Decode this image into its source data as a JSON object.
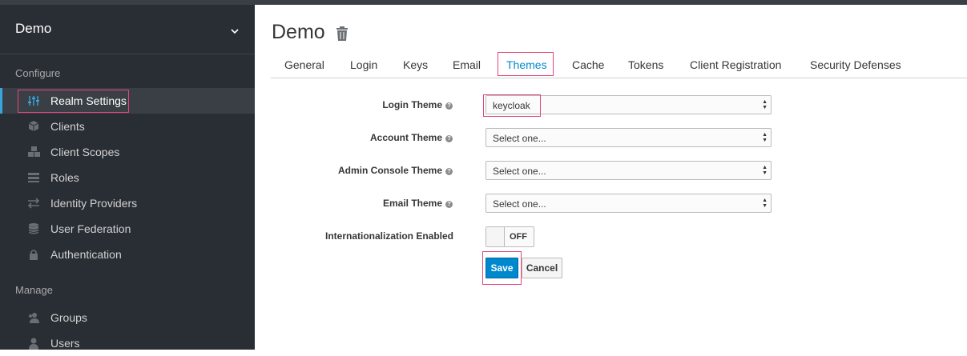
{
  "sidebar": {
    "realm_name": "Demo",
    "sections": {
      "configure": "Configure",
      "manage": "Manage"
    },
    "items": [
      {
        "label": "Realm Settings",
        "icon": "sliders-icon"
      },
      {
        "label": "Clients",
        "icon": "cube-icon"
      },
      {
        "label": "Client Scopes",
        "icon": "cubes-icon"
      },
      {
        "label": "Roles",
        "icon": "list-icon"
      },
      {
        "label": "Identity Providers",
        "icon": "exchange-icon"
      },
      {
        "label": "User Federation",
        "icon": "database-icon"
      },
      {
        "label": "Authentication",
        "icon": "lock-icon"
      },
      {
        "label": "Groups",
        "icon": "users-icon"
      },
      {
        "label": "Users",
        "icon": "user-icon"
      }
    ]
  },
  "main": {
    "title": "Demo",
    "tabs": [
      {
        "label": "General"
      },
      {
        "label": "Login"
      },
      {
        "label": "Keys"
      },
      {
        "label": "Email"
      },
      {
        "label": "Themes"
      },
      {
        "label": "Cache"
      },
      {
        "label": "Tokens"
      },
      {
        "label": "Client Registration"
      },
      {
        "label": "Security Defenses"
      }
    ],
    "active_tab": "Themes",
    "form": {
      "login_theme": {
        "label": "Login Theme",
        "value": "keycloak"
      },
      "account_theme": {
        "label": "Account Theme",
        "value": "Select one..."
      },
      "admin_console_theme": {
        "label": "Admin Console Theme",
        "value": "Select one..."
      },
      "email_theme": {
        "label": "Email Theme",
        "value": "Select one..."
      },
      "internationalization": {
        "label": "Internationalization Enabled",
        "state": "OFF"
      }
    },
    "buttons": {
      "save": "Save",
      "cancel": "Cancel"
    }
  },
  "colors": {
    "sidebar_bg": "#292e34",
    "accent": "#0088ce",
    "highlight": "#e4467c"
  }
}
